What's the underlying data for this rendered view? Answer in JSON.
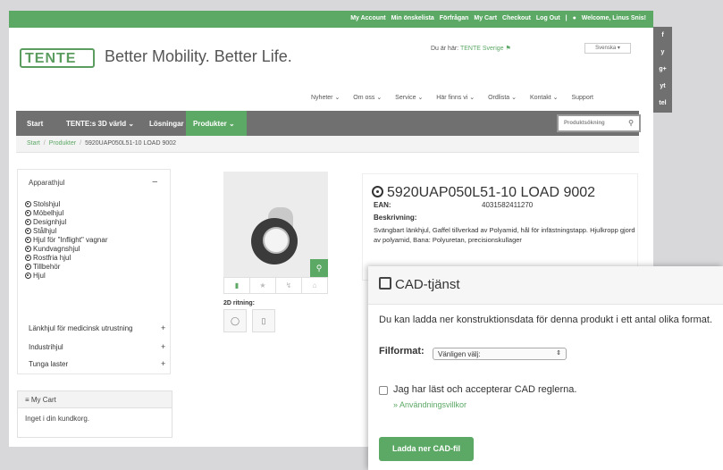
{
  "topbar": {
    "links": [
      "My Account",
      "Min önskelista",
      "Förfrågan",
      "My Cart",
      "Checkout",
      "Log Out",
      "|"
    ],
    "welcome": "Welcome, Linus Snis!"
  },
  "brand": {
    "logo": "TENTE",
    "tagline": "Better Mobility. Better Life."
  },
  "location": {
    "prefix": "Du är här:",
    "site": "TENTE Sverige"
  },
  "language": "Svenska ▾",
  "main_nav": [
    "Nyheter ⌄",
    "Om oss ⌄",
    "Service ⌄",
    "Här finns vi ⌄",
    "Ordlista ⌄",
    "Kontakt ⌄",
    "Support"
  ],
  "category_nav": {
    "items": [
      "Start",
      "TENTE:s 3D värld ⌄",
      "Lösningar",
      "Produkter ⌄"
    ],
    "search_placeholder": "Produktsökning"
  },
  "breadcrumb": [
    "Start",
    "Produkter",
    "5920UAP050L51-10 LOAD 9002"
  ],
  "sidebar": {
    "heading": "Apparathjul",
    "collapse": "–",
    "items": [
      "Stolshjul",
      "Möbelhjul",
      "Designhjul",
      "Stålhjul",
      "Hjul för \"Inflight\" vagnar",
      "Kundvagnshjul",
      "Rostfria hjul",
      "Tillbehör",
      "Hjul"
    ],
    "sections": [
      "Länkhjul för medicinsk utrustning",
      "Industrihjul",
      "Tunga laster"
    ],
    "expand": "+"
  },
  "cart": {
    "title": "≡ My Cart",
    "empty": "Inget i din kundkorg."
  },
  "product": {
    "title": "5920UAP050L51-10 LOAD 9002",
    "ean_label": "EAN:",
    "ean": "4031582411270",
    "desc_label": "Beskrivning:",
    "description": "Svängbart länkhjul, Gaffel tillverkad av Polyamid, hål för infästningstapp. Hjulkropp gjord av polyamid, Bana: Polyuretan, precisionskullager",
    "drawing_label": "2D ritning:"
  },
  "social": [
    "f",
    "y",
    "g+",
    "yt",
    "tel"
  ],
  "modal": {
    "title": "CAD-tjänst",
    "text": "Du kan ladda ner konstruktionsdata för denna produkt i ett antal olika format.",
    "format_label": "Filformat:",
    "format_value": "Vänligen välj:",
    "accept_label": "Jag har läst och accepterar CAD reglerna.",
    "terms_link": "» Användningsvillkor",
    "download_label": "Ladda ner CAD-fil"
  },
  "colors": {
    "accent": "#5ca865",
    "nav": "#707070"
  }
}
